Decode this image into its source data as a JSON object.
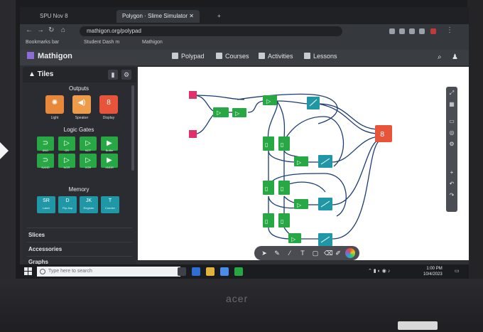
{
  "browser": {
    "tabs": [
      {
        "label": "SPU Nov 8"
      },
      {
        "label": "Polygon · Slime Simulator",
        "active": true
      }
    ],
    "url": "mathigon.org/polypad",
    "bookmarks": [
      "Bookmarks bar",
      "Student Dash m",
      "Mathigon"
    ]
  },
  "app": {
    "name": "Mathigon",
    "nav": [
      "Polypad",
      "Courses",
      "Activities",
      "Lessons"
    ]
  },
  "sidebar": {
    "title": "Tiles",
    "sections": {
      "outputs": {
        "label": "Outputs",
        "items": [
          {
            "label": "Light",
            "color": "#e8883a",
            "icon": "✺"
          },
          {
            "label": "Speaker",
            "color": "#ef9c4a",
            "icon": "◀)"
          },
          {
            "label": "Display",
            "color": "#e8543a",
            "icon": "8"
          }
        ]
      },
      "logic_gates": {
        "label": "Logic Gates",
        "items": [
          "AND",
          "OR",
          "NOT",
          "Buffer",
          "NAND",
          "NOR",
          "XOR",
          "XNOR"
        ]
      },
      "memory": {
        "label": "Memory",
        "items": [
          {
            "label": "Latch",
            "sub": "SR"
          },
          {
            "label": "Flip-flop",
            "sub": "D"
          },
          {
            "label": "Register",
            "sub": "JK"
          },
          {
            "label": "Counter",
            "sub": "T"
          }
        ]
      }
    },
    "categories": [
      "Slices",
      "Accessories",
      "Graphs"
    ]
  },
  "taskbar": {
    "search_placeholder": "Type here to search",
    "time": "1:00 PM",
    "date": "10/4/2023"
  },
  "laptop_brand": "acer",
  "colors": {
    "gate_green": "#27a844",
    "node_teal": "#1f97a6",
    "input_pink": "#e0306e",
    "output_red": "#e8543a",
    "wire_navy": "#1a3c74"
  }
}
